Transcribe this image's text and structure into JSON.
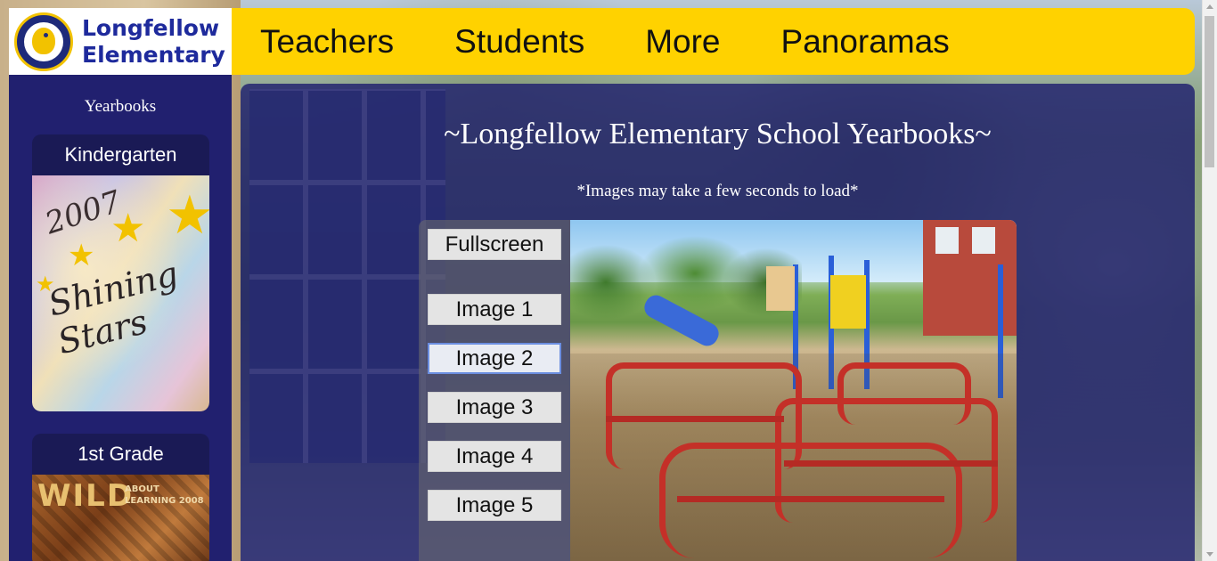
{
  "logo": {
    "line1": "Longfellow",
    "line2": "Elementary"
  },
  "nav": {
    "items": [
      {
        "label": "Teachers"
      },
      {
        "label": "Students"
      },
      {
        "label": "More"
      },
      {
        "label": "Panoramas"
      }
    ]
  },
  "sidebar": {
    "title": "Yearbooks",
    "books": [
      {
        "label": "Kindergarten",
        "cover": {
          "year": "2007",
          "title": "Shining Stars"
        }
      },
      {
        "label": "1st Grade",
        "cover": {
          "title": "WILD",
          "subtitle": "ABOUT LEARNING 2008"
        }
      }
    ]
  },
  "main": {
    "title": "~Longfellow Elementary School Yearbooks~",
    "note": "*Images may take a few seconds to load*",
    "viewer": {
      "fullscreen_label": "Fullscreen",
      "image_buttons": [
        {
          "label": "Image 1"
        },
        {
          "label": "Image 2",
          "active": true
        },
        {
          "label": "Image 3"
        },
        {
          "label": "Image 4"
        },
        {
          "label": "Image 5"
        }
      ],
      "current_image": "playground"
    }
  },
  "colors": {
    "header": "#ffd200",
    "sidebar": "#21206f",
    "main_panel": "#1e1e6e",
    "logo_text": "#1e2a9c"
  }
}
